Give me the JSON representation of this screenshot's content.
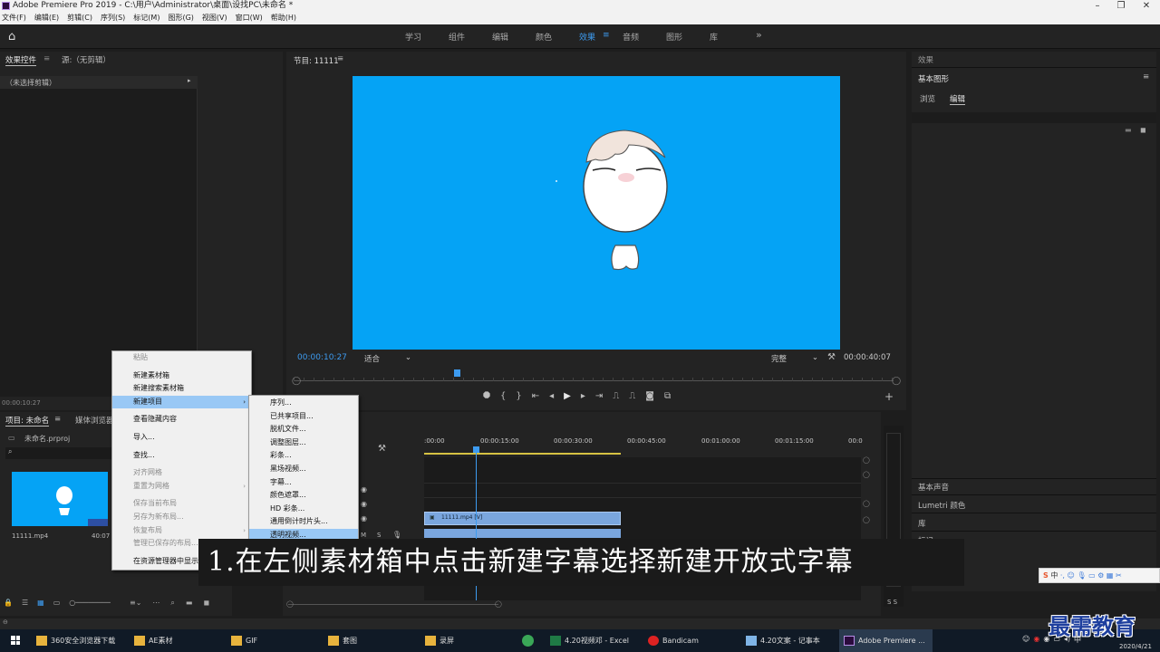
{
  "window": {
    "title": "Adobe Premiere Pro 2019 - C:\\用户\\Administrator\\桌面\\设找PC\\未命名 *"
  },
  "menu": [
    "文件(F)",
    "编辑(E)",
    "剪辑(C)",
    "序列(S)",
    "标记(M)",
    "图形(G)",
    "视图(V)",
    "窗口(W)",
    "帮助(H)"
  ],
  "workspaces": [
    "学习",
    "组件",
    "编辑",
    "颜色",
    "效果",
    "音频",
    "图形",
    "库"
  ],
  "active_workspace": "效果",
  "left_panel": {
    "tab_active": "效果控件",
    "tab_source": "源:（无剪辑）",
    "no_clip": "（未选择剪辑）",
    "timecode": "00:00:10:27"
  },
  "program": {
    "title": "节目: 11111",
    "timecode": "00:00:10:27",
    "fit": "适合",
    "quality": "完整",
    "duration": "00:00:40:07"
  },
  "right_panel": {
    "effects_title": "效果",
    "title": "基本图形",
    "tab_browse": "浏览",
    "tab_edit": "编辑",
    "basic_sound": "基本声音",
    "lumetri": "Lumetri 颜色",
    "library": "库",
    "marker": "标记"
  },
  "project": {
    "tab": "项目: 未命名",
    "tab2": "媒体浏览器",
    "file": "未命名.prproj",
    "clip_name": "11111.mp4",
    "clip_dur": "40:07"
  },
  "context_menu": [
    {
      "label": "粘贴",
      "disabled": true
    },
    {
      "label": "新建素材箱",
      "disabled": false
    },
    {
      "label": "新建搜索素材箱",
      "disabled": false
    },
    {
      "label": "新建项目",
      "disabled": false,
      "sub": true,
      "hl": true
    },
    {
      "label": "查看隐藏内容",
      "disabled": false
    },
    {
      "label": "导入...",
      "disabled": false
    },
    {
      "label": "查找...",
      "disabled": false
    },
    {
      "label": "对齐网格",
      "disabled": true
    },
    {
      "label": "重置为网格",
      "disabled": true,
      "sub": true
    },
    {
      "label": "保存当前布局",
      "disabled": true
    },
    {
      "label": "另存为新布局...",
      "disabled": true
    },
    {
      "label": "恢复布局",
      "disabled": true,
      "sub": true
    },
    {
      "label": "管理已保存的布局...",
      "disabled": true
    },
    {
      "label": "在资源管理器中显示项目...",
      "disabled": false
    }
  ],
  "submenu": [
    "序列...",
    "已共享项目...",
    "脱机文件...",
    "调整图层...",
    "彩条...",
    "黑场视频...",
    "字幕...",
    "颜色遮罩...",
    "HD 彩条...",
    "通用倒计时片头...",
    "透明视频..."
  ],
  "timeline": {
    "ticks": [
      ":00:00",
      "00:00:15:00",
      "00:00:30:00",
      "00:00:45:00",
      "00:01:00:00",
      "00:01:15:00",
      "00:0"
    ],
    "clip_label": "11111.mp4 [V]"
  },
  "subtitle": "1.在左侧素材箱中点击新建字幕选择新建开放式字幕",
  "watermark": "最需教育",
  "taskbar": [
    {
      "label": "360安全浏览器下载",
      "icon": "folder-icon"
    },
    {
      "label": "AE素材",
      "icon": "folder-icon"
    },
    {
      "label": "GIF",
      "icon": "folder-icon"
    },
    {
      "label": "套图",
      "icon": "folder-icon"
    },
    {
      "label": "录屏",
      "icon": "folder-icon"
    },
    {
      "label": "",
      "icon": "chrome-icon"
    },
    {
      "label": "4.20视频邓 - Excel",
      "icon": "excel-icon"
    },
    {
      "label": "Bandicam",
      "icon": "bandicam-icon"
    },
    {
      "label": "4.20文案 - 记事本",
      "icon": "notepad-icon"
    },
    {
      "label": "Adobe Premiere ...",
      "icon": "premiere-icon"
    }
  ],
  "tray": {
    "ime": "中",
    "date": "2020/4/21"
  },
  "colors": {
    "monitor_bg": "#05a3f5",
    "accent": "#3d9bf0",
    "menu_highlight": "#99c8f5"
  }
}
